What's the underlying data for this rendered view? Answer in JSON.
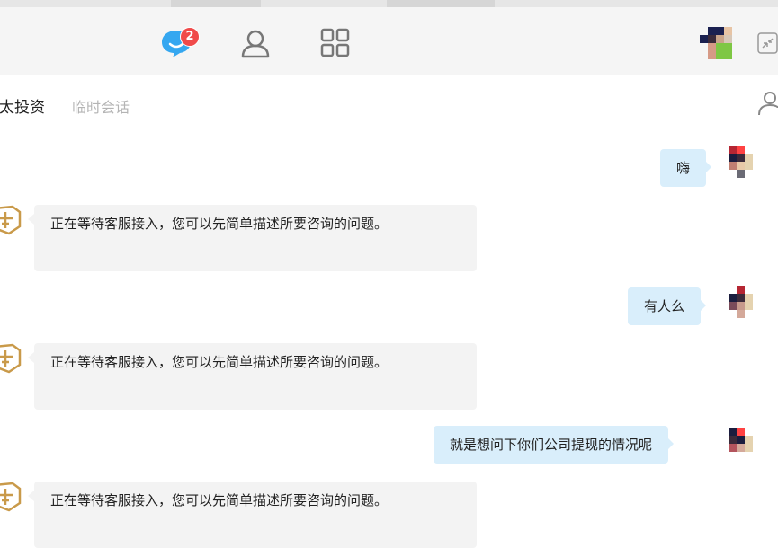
{
  "toolbar": {
    "chat_badge_count": "2",
    "icons": [
      "chat-icon",
      "contacts-icon",
      "apps-icon",
      "minimize-icon"
    ],
    "accent_color": "#35a7f0",
    "badge_color": "#f04a4a"
  },
  "conversation": {
    "name": "泛太投资",
    "tag": "临时会话"
  },
  "messages": [
    {
      "from": "me",
      "text": "嗨"
    },
    {
      "from": "service",
      "text": "正在等待客服接入，您可以先简单描述所要咨询的问题。"
    },
    {
      "from": "me",
      "text": "有人么"
    },
    {
      "from": "service",
      "text": "正在等待客服接入，您可以先简单描述所要咨询的问题。"
    },
    {
      "from": "me",
      "text": "就是想问下你们公司提现的情况呢"
    },
    {
      "from": "service",
      "text": "正在等待客服接入，您可以先简单描述所要咨询的问题。"
    }
  ]
}
